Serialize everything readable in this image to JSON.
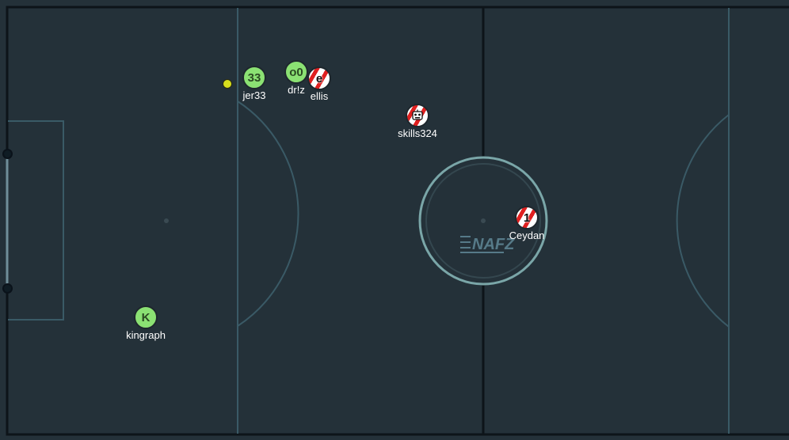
{
  "colors": {
    "field": "#243139",
    "lines": "#3a5a66",
    "border": "#0d1419",
    "red_team": "#e02020",
    "green_team": "#8be173",
    "ball": "#d8df1e",
    "center_circle": "#7aa6a8"
  },
  "logo_text": "NAFZ",
  "players": [
    {
      "name": "jer33",
      "avatar": "33",
      "team": "green"
    },
    {
      "name": "dr!z",
      "avatar": "o0",
      "team": "green"
    },
    {
      "name": "ellis",
      "avatar": "e",
      "team": "red"
    },
    {
      "name": "skills324",
      "avatar": "robot-face-icon",
      "team": "red"
    },
    {
      "name": "Ceydan",
      "avatar": "1",
      "team": "red"
    },
    {
      "name": "kingraph",
      "avatar": "K",
      "team": "green"
    }
  ]
}
